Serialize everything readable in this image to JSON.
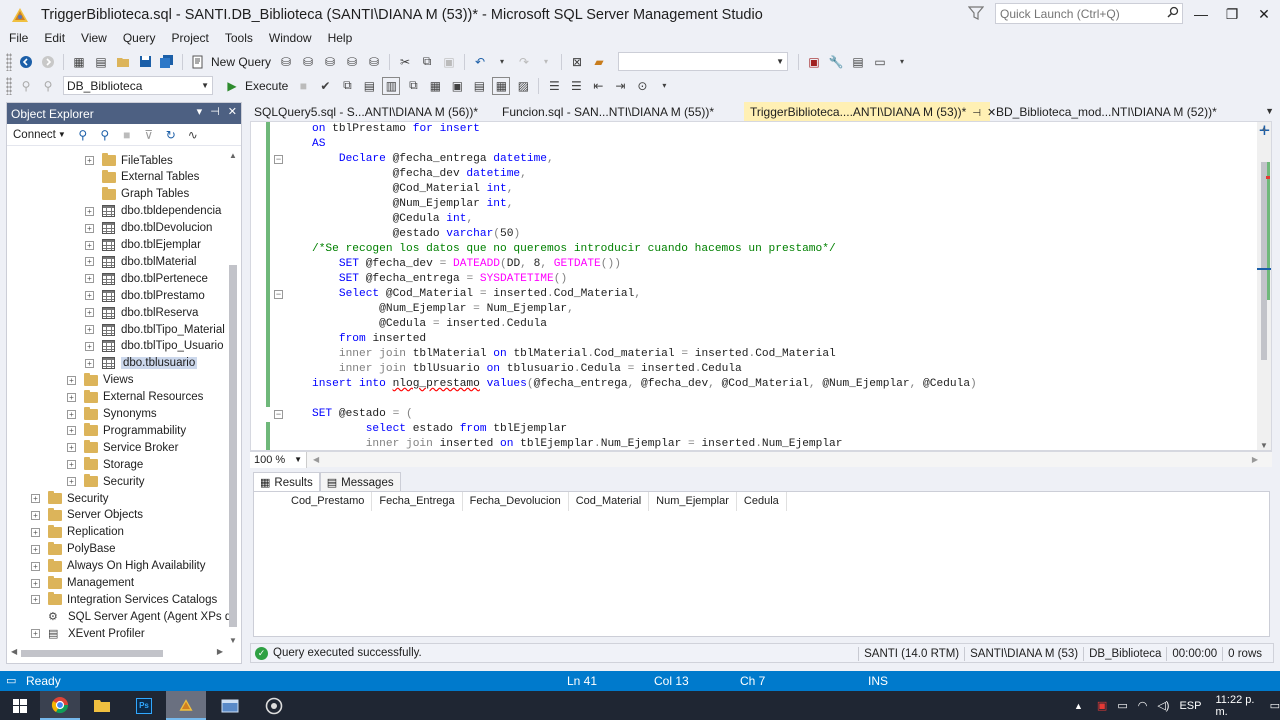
{
  "window": {
    "title": "TriggerBiblioteca.sql - SANTI.DB_Biblioteca (SANTI\\DIANA M (53))* - Microsoft SQL Server Management Studio",
    "quick_launch_placeholder": "Quick Launch (Ctrl+Q)"
  },
  "menu": [
    "File",
    "Edit",
    "View",
    "Query",
    "Project",
    "Tools",
    "Window",
    "Help"
  ],
  "toolbar": {
    "new_query_label": "New Query",
    "execute_label": "Execute",
    "database_selected": "DB_Biblioteca"
  },
  "object_explorer": {
    "title": "Object Explorer",
    "connect_label": "Connect",
    "tree": [
      {
        "label": "FileTables",
        "type": "folder",
        "expand": true
      },
      {
        "label": "External Tables",
        "type": "folder",
        "expand": false
      },
      {
        "label": "Graph Tables",
        "type": "folder",
        "expand": false
      },
      {
        "label": "dbo.tbldependencia",
        "type": "table",
        "expand": true
      },
      {
        "label": "dbo.tblDevolucion",
        "type": "table",
        "expand": true
      },
      {
        "label": "dbo.tblEjemplar",
        "type": "table",
        "expand": true
      },
      {
        "label": "dbo.tblMaterial",
        "type": "table",
        "expand": true
      },
      {
        "label": "dbo.tblPertenece",
        "type": "table",
        "expand": true
      },
      {
        "label": "dbo.tblPrestamo",
        "type": "table",
        "expand": true
      },
      {
        "label": "dbo.tblReserva",
        "type": "table",
        "expand": true
      },
      {
        "label": "dbo.tblTipo_Material",
        "type": "table",
        "expand": true
      },
      {
        "label": "dbo.tblTipo_Usuario",
        "type": "table",
        "expand": true
      },
      {
        "label": "dbo.tblusuario",
        "type": "table",
        "expand": true,
        "selected": true
      },
      {
        "label": "Views",
        "type": "folder",
        "expand": true
      },
      {
        "label": "External Resources",
        "type": "folder",
        "expand": true
      },
      {
        "label": "Synonyms",
        "type": "folder",
        "expand": true
      },
      {
        "label": "Programmability",
        "type": "folder",
        "expand": true
      },
      {
        "label": "Service Broker",
        "type": "folder",
        "expand": true
      },
      {
        "label": "Storage",
        "type": "folder",
        "expand": true
      },
      {
        "label": "Security",
        "type": "folder",
        "expand": true
      },
      {
        "label": "Security",
        "type": "folder",
        "expand": true
      },
      {
        "label": "Server Objects",
        "type": "folder",
        "expand": true
      },
      {
        "label": "Replication",
        "type": "folder",
        "expand": true
      },
      {
        "label": "PolyBase",
        "type": "folder",
        "expand": true
      },
      {
        "label": "Always On High Availability",
        "type": "folder",
        "expand": true
      },
      {
        "label": "Management",
        "type": "folder",
        "expand": true
      },
      {
        "label": "Integration Services Catalogs",
        "type": "folder",
        "expand": true
      },
      {
        "label": "SQL Server Agent (Agent XPs dis",
        "type": "agent",
        "expand": false
      },
      {
        "label": "XEvent Profiler",
        "type": "profiler",
        "expand": true
      }
    ]
  },
  "tabs": [
    {
      "label": "SQLQuery5.sql - S...ANTI\\DIANA M (56))*",
      "active": false
    },
    {
      "label": "Funcion.sql - SAN...NTI\\DIANA M (55))*",
      "active": false
    },
    {
      "label": "TriggerBiblioteca....ANTI\\DIANA M (53))*",
      "active": true
    },
    {
      "label": "BD_Biblioteca_mod...NTI\\DIANA M (52))*",
      "active": false
    }
  ],
  "editor": {
    "zoom": "100 %",
    "lines": [
      [
        [
          "kw",
          "on "
        ],
        [
          "plain",
          "tblPrestamo "
        ],
        [
          "kw",
          "for insert"
        ]
      ],
      [
        [
          "kw",
          "AS"
        ]
      ],
      [
        [
          "plain",
          "    "
        ],
        [
          "kw",
          "Declare "
        ],
        [
          "plain",
          "@fecha_entrega "
        ],
        [
          "kw",
          "datetime"
        ],
        [
          "gr",
          ","
        ]
      ],
      [
        [
          "plain",
          "            @fecha_dev "
        ],
        [
          "kw",
          "datetime"
        ],
        [
          "gr",
          ","
        ]
      ],
      [
        [
          "plain",
          "            @Cod_Material "
        ],
        [
          "kw",
          "int"
        ],
        [
          "gr",
          ","
        ]
      ],
      [
        [
          "plain",
          "            @Num_Ejemplar "
        ],
        [
          "kw",
          "int"
        ],
        [
          "gr",
          ","
        ]
      ],
      [
        [
          "plain",
          "            @Cedula "
        ],
        [
          "kw",
          "int"
        ],
        [
          "gr",
          ","
        ]
      ],
      [
        [
          "plain",
          "            @estado "
        ],
        [
          "kw",
          "varchar"
        ],
        [
          "gr",
          "("
        ],
        [
          "plain",
          "50"
        ],
        [
          "gr",
          ")"
        ]
      ],
      [
        [
          "cm",
          "/*Se recogen los datos que no queremos introducir cuando hacemos un prestamo*/"
        ]
      ],
      [
        [
          "plain",
          "    "
        ],
        [
          "kw",
          "SET "
        ],
        [
          "plain",
          "@fecha_dev "
        ],
        [
          "gr",
          "= "
        ],
        [
          "fn",
          "DATEADD"
        ],
        [
          "gr",
          "("
        ],
        [
          "plain",
          "DD"
        ],
        [
          "gr",
          ", "
        ],
        [
          "plain",
          "8"
        ],
        [
          "gr",
          ", "
        ],
        [
          "fn",
          "GETDATE"
        ],
        [
          "gr",
          "())"
        ]
      ],
      [
        [
          "plain",
          "    "
        ],
        [
          "kw",
          "SET "
        ],
        [
          "plain",
          "@fecha_entrega "
        ],
        [
          "gr",
          "= "
        ],
        [
          "fn",
          "SYSDATETIME"
        ],
        [
          "gr",
          "()"
        ]
      ],
      [
        [
          "plain",
          "    "
        ],
        [
          "kw",
          "Select "
        ],
        [
          "plain",
          "@Cod_Material "
        ],
        [
          "gr",
          "= "
        ],
        [
          "plain",
          "inserted"
        ],
        [
          "gr",
          "."
        ],
        [
          "plain",
          "Cod_Material"
        ],
        [
          "gr",
          ","
        ]
      ],
      [
        [
          "plain",
          "          @Num_Ejemplar "
        ],
        [
          "gr",
          "= "
        ],
        [
          "plain",
          "Num_Ejemplar"
        ],
        [
          "gr",
          ","
        ]
      ],
      [
        [
          "plain",
          "          @Cedula "
        ],
        [
          "gr",
          "= "
        ],
        [
          "plain",
          "inserted"
        ],
        [
          "gr",
          "."
        ],
        [
          "plain",
          "Cedula"
        ]
      ],
      [
        [
          "plain",
          "    "
        ],
        [
          "kw",
          "from "
        ],
        [
          "plain",
          "inserted"
        ]
      ],
      [
        [
          "plain",
          "    "
        ],
        [
          "gr",
          "inner join "
        ],
        [
          "plain",
          "tblMaterial "
        ],
        [
          "kw",
          "on "
        ],
        [
          "plain",
          "tblMaterial"
        ],
        [
          "gr",
          "."
        ],
        [
          "plain",
          "Cod_material "
        ],
        [
          "gr",
          "= "
        ],
        [
          "plain",
          "inserted"
        ],
        [
          "gr",
          "."
        ],
        [
          "plain",
          "Cod_Material"
        ]
      ],
      [
        [
          "plain",
          "    "
        ],
        [
          "gr",
          "inner join "
        ],
        [
          "plain",
          "tblUsuario "
        ],
        [
          "kw",
          "on "
        ],
        [
          "plain",
          "tblusuario"
        ],
        [
          "gr",
          "."
        ],
        [
          "plain",
          "Cedula "
        ],
        [
          "gr",
          "= "
        ],
        [
          "plain",
          "inserted"
        ],
        [
          "gr",
          "."
        ],
        [
          "plain",
          "Cedula"
        ]
      ],
      [
        [
          "kw",
          "insert into "
        ],
        [
          "err",
          "nlog_prestamo"
        ],
        [
          "kw",
          " values"
        ],
        [
          "gr",
          "("
        ],
        [
          "plain",
          "@fecha_entrega"
        ],
        [
          "gr",
          ", "
        ],
        [
          "plain",
          "@fecha_dev"
        ],
        [
          "gr",
          ", "
        ],
        [
          "plain",
          "@Cod_Material"
        ],
        [
          "gr",
          ", "
        ],
        [
          "plain",
          "@Num_Ejemplar"
        ],
        [
          "gr",
          ", "
        ],
        [
          "plain",
          "@Cedula"
        ],
        [
          "gr",
          ")"
        ]
      ],
      [],
      [
        [
          "kw",
          "SET "
        ],
        [
          "plain",
          "@estado "
        ],
        [
          "gr",
          "= ("
        ]
      ],
      [
        [
          "plain",
          "        "
        ],
        [
          "kw",
          "select "
        ],
        [
          "plain",
          "estado "
        ],
        [
          "kw",
          "from "
        ],
        [
          "plain",
          "tblEjemplar"
        ]
      ],
      [
        [
          "plain",
          "        "
        ],
        [
          "gr",
          "inner join "
        ],
        [
          "plain",
          "inserted "
        ],
        [
          "kw",
          "on "
        ],
        [
          "plain",
          "tblEjemplar"
        ],
        [
          "gr",
          "."
        ],
        [
          "plain",
          "Num_Ejemplar "
        ],
        [
          "gr",
          "= "
        ],
        [
          "plain",
          "inserted"
        ],
        [
          "gr",
          "."
        ],
        [
          "plain",
          "Num_Ejemplar"
        ]
      ]
    ]
  },
  "results": {
    "tab_results": "Results",
    "tab_messages": "Messages",
    "columns": [
      "Cod_Prestamo",
      "Fecha_Entrega",
      "Fecha_Devolucion",
      "Cod_Material",
      "Num_Ejemplar",
      "Cedula"
    ]
  },
  "query_status": {
    "message": "Query executed successfully.",
    "server": "SANTI (14.0 RTM)",
    "user": "SANTI\\DIANA M (53)",
    "database": "DB_Biblioteca",
    "elapsed": "00:00:00",
    "rows": "0 rows"
  },
  "status_bar": {
    "state": "Ready",
    "ln": "Ln 41",
    "col": "Col 13",
    "ch": "Ch 7",
    "mode": "INS"
  },
  "taskbar": {
    "language": "ESP",
    "time": "11:22 p. m."
  },
  "colors": {
    "accent_blue": "#007acc",
    "panel_title": "#4d6082",
    "active_tab": "#fff0b4",
    "keyword": "#0000ff",
    "function": "#ff00ff",
    "comment": "#008000"
  }
}
